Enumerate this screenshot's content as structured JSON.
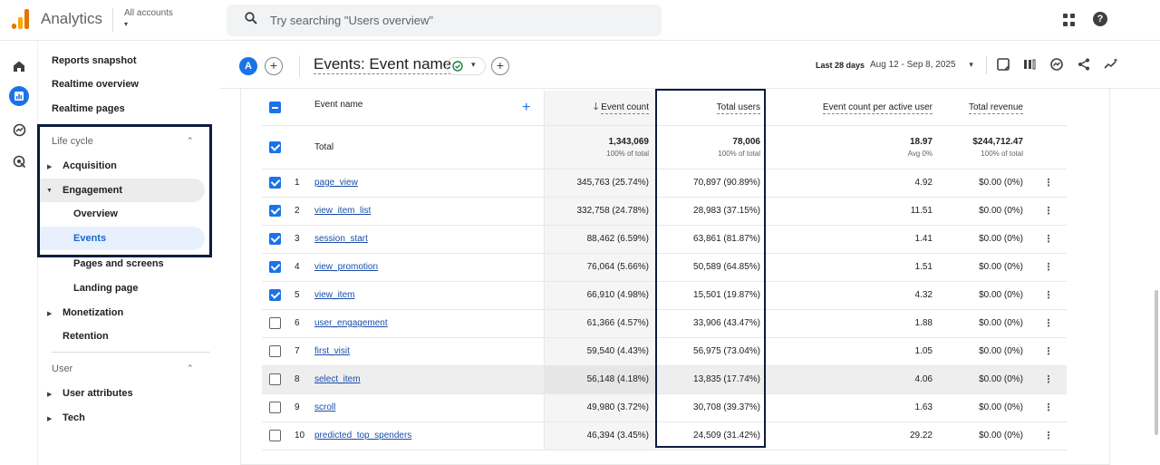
{
  "topbar": {
    "app_title": "Analytics",
    "account_label": "All accounts",
    "account_caret": "▾",
    "search_placeholder": "Try searching \"Users overview\"",
    "help_glyph": "?"
  },
  "nav": {
    "reports_snapshot": "Reports snapshot",
    "realtime_overview": "Realtime overview",
    "realtime_pages": "Realtime pages",
    "lifecycle": {
      "title": "Life cycle",
      "acquisition": "Acquisition",
      "engagement": "Engagement",
      "overview": "Overview",
      "events": "Events",
      "pages_screens": "Pages and screens",
      "landing_page": "Landing page",
      "monetization": "Monetization",
      "retention": "Retention"
    },
    "user": {
      "title": "User",
      "user_attributes": "User attributes",
      "tech": "Tech"
    }
  },
  "report": {
    "avatar_letter": "A",
    "title": "Events: Event name",
    "date_label": "Last 28 days",
    "date_range": "Aug 12 - Sep 8, 2025",
    "date_caret": "▾"
  },
  "table": {
    "headers": {
      "event_name": "Event name",
      "event_count": "Event count",
      "total_users": "Total users",
      "event_count_per_user": "Event count per active user",
      "total_revenue": "Total revenue"
    },
    "total": {
      "label": "Total",
      "event_count": "1,343,069",
      "event_count_sub": "100% of total",
      "total_users": "78,006",
      "total_users_sub": "100% of total",
      "ecpu": "18.97",
      "ecpu_sub": "Avg 0%",
      "revenue": "$244,712.47",
      "revenue_sub": "100% of total"
    },
    "rows": [
      {
        "num": "1",
        "name": "page_view",
        "event_count": "345,763 (25.74%)",
        "total_users": "70,897 (90.89%)",
        "ecpu": "4.92",
        "revenue": "$0.00 (0%)",
        "checked": true
      },
      {
        "num": "2",
        "name": "view_item_list",
        "event_count": "332,758 (24.78%)",
        "total_users": "28,983 (37.15%)",
        "ecpu": "11.51",
        "revenue": "$0.00 (0%)",
        "checked": true
      },
      {
        "num": "3",
        "name": "session_start",
        "event_count": "88,462 (6.59%)",
        "total_users": "63,861 (81.87%)",
        "ecpu": "1.41",
        "revenue": "$0.00 (0%)",
        "checked": true
      },
      {
        "num": "4",
        "name": "view_promotion",
        "event_count": "76,064 (5.66%)",
        "total_users": "50,589 (64.85%)",
        "ecpu": "1.51",
        "revenue": "$0.00 (0%)",
        "checked": true
      },
      {
        "num": "5",
        "name": "view_item",
        "event_count": "66,910 (4.98%)",
        "total_users": "15,501 (19.87%)",
        "ecpu": "4.32",
        "revenue": "$0.00 (0%)",
        "checked": true
      },
      {
        "num": "6",
        "name": "user_engagement",
        "event_count": "61,366 (4.57%)",
        "total_users": "33,906 (43.47%)",
        "ecpu": "1.88",
        "revenue": "$0.00 (0%)",
        "checked": false
      },
      {
        "num": "7",
        "name": "first_visit",
        "event_count": "59,540 (4.43%)",
        "total_users": "56,975 (73.04%)",
        "ecpu": "1.05",
        "revenue": "$0.00 (0%)",
        "checked": false
      },
      {
        "num": "8",
        "name": "select_item",
        "event_count": "56,148 (4.18%)",
        "total_users": "13,835 (17.74%)",
        "ecpu": "4.06",
        "revenue": "$0.00 (0%)",
        "checked": false
      },
      {
        "num": "9",
        "name": "scroll",
        "event_count": "49,980 (3.72%)",
        "total_users": "30,708 (39.37%)",
        "ecpu": "1.63",
        "revenue": "$0.00 (0%)",
        "checked": false
      },
      {
        "num": "10",
        "name": "predicted_top_spenders",
        "event_count": "46,394 (3.45%)",
        "total_users": "24,509 (31.42%)",
        "ecpu": "29.22",
        "revenue": "$0.00 (0%)",
        "checked": false
      }
    ]
  },
  "colors": {
    "accent": "#1a73e8",
    "link": "#1a4ea8",
    "highlight_box": "#0d1b3e"
  }
}
